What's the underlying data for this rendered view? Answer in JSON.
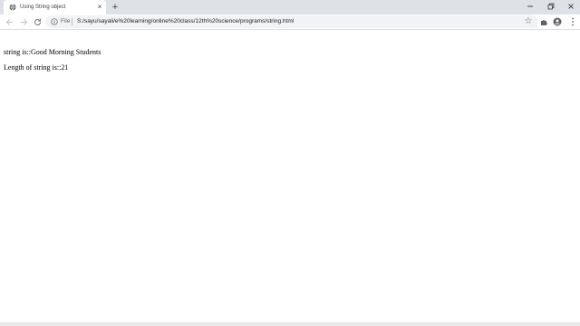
{
  "browser": {
    "tab": {
      "title": "Using String object",
      "close_glyph": "×",
      "favicon": "globe-icon"
    },
    "new_tab_glyph": "+",
    "address_bar": {
      "scheme_label": "File",
      "url": "S:/sayu/sayali/e%20learning/online%20class/12th%20science/programs/string.html"
    },
    "bookmark_glyph": "☆"
  },
  "page": {
    "line1": "string is::Good Morning Students",
    "line2": "Length of string is::21"
  }
}
